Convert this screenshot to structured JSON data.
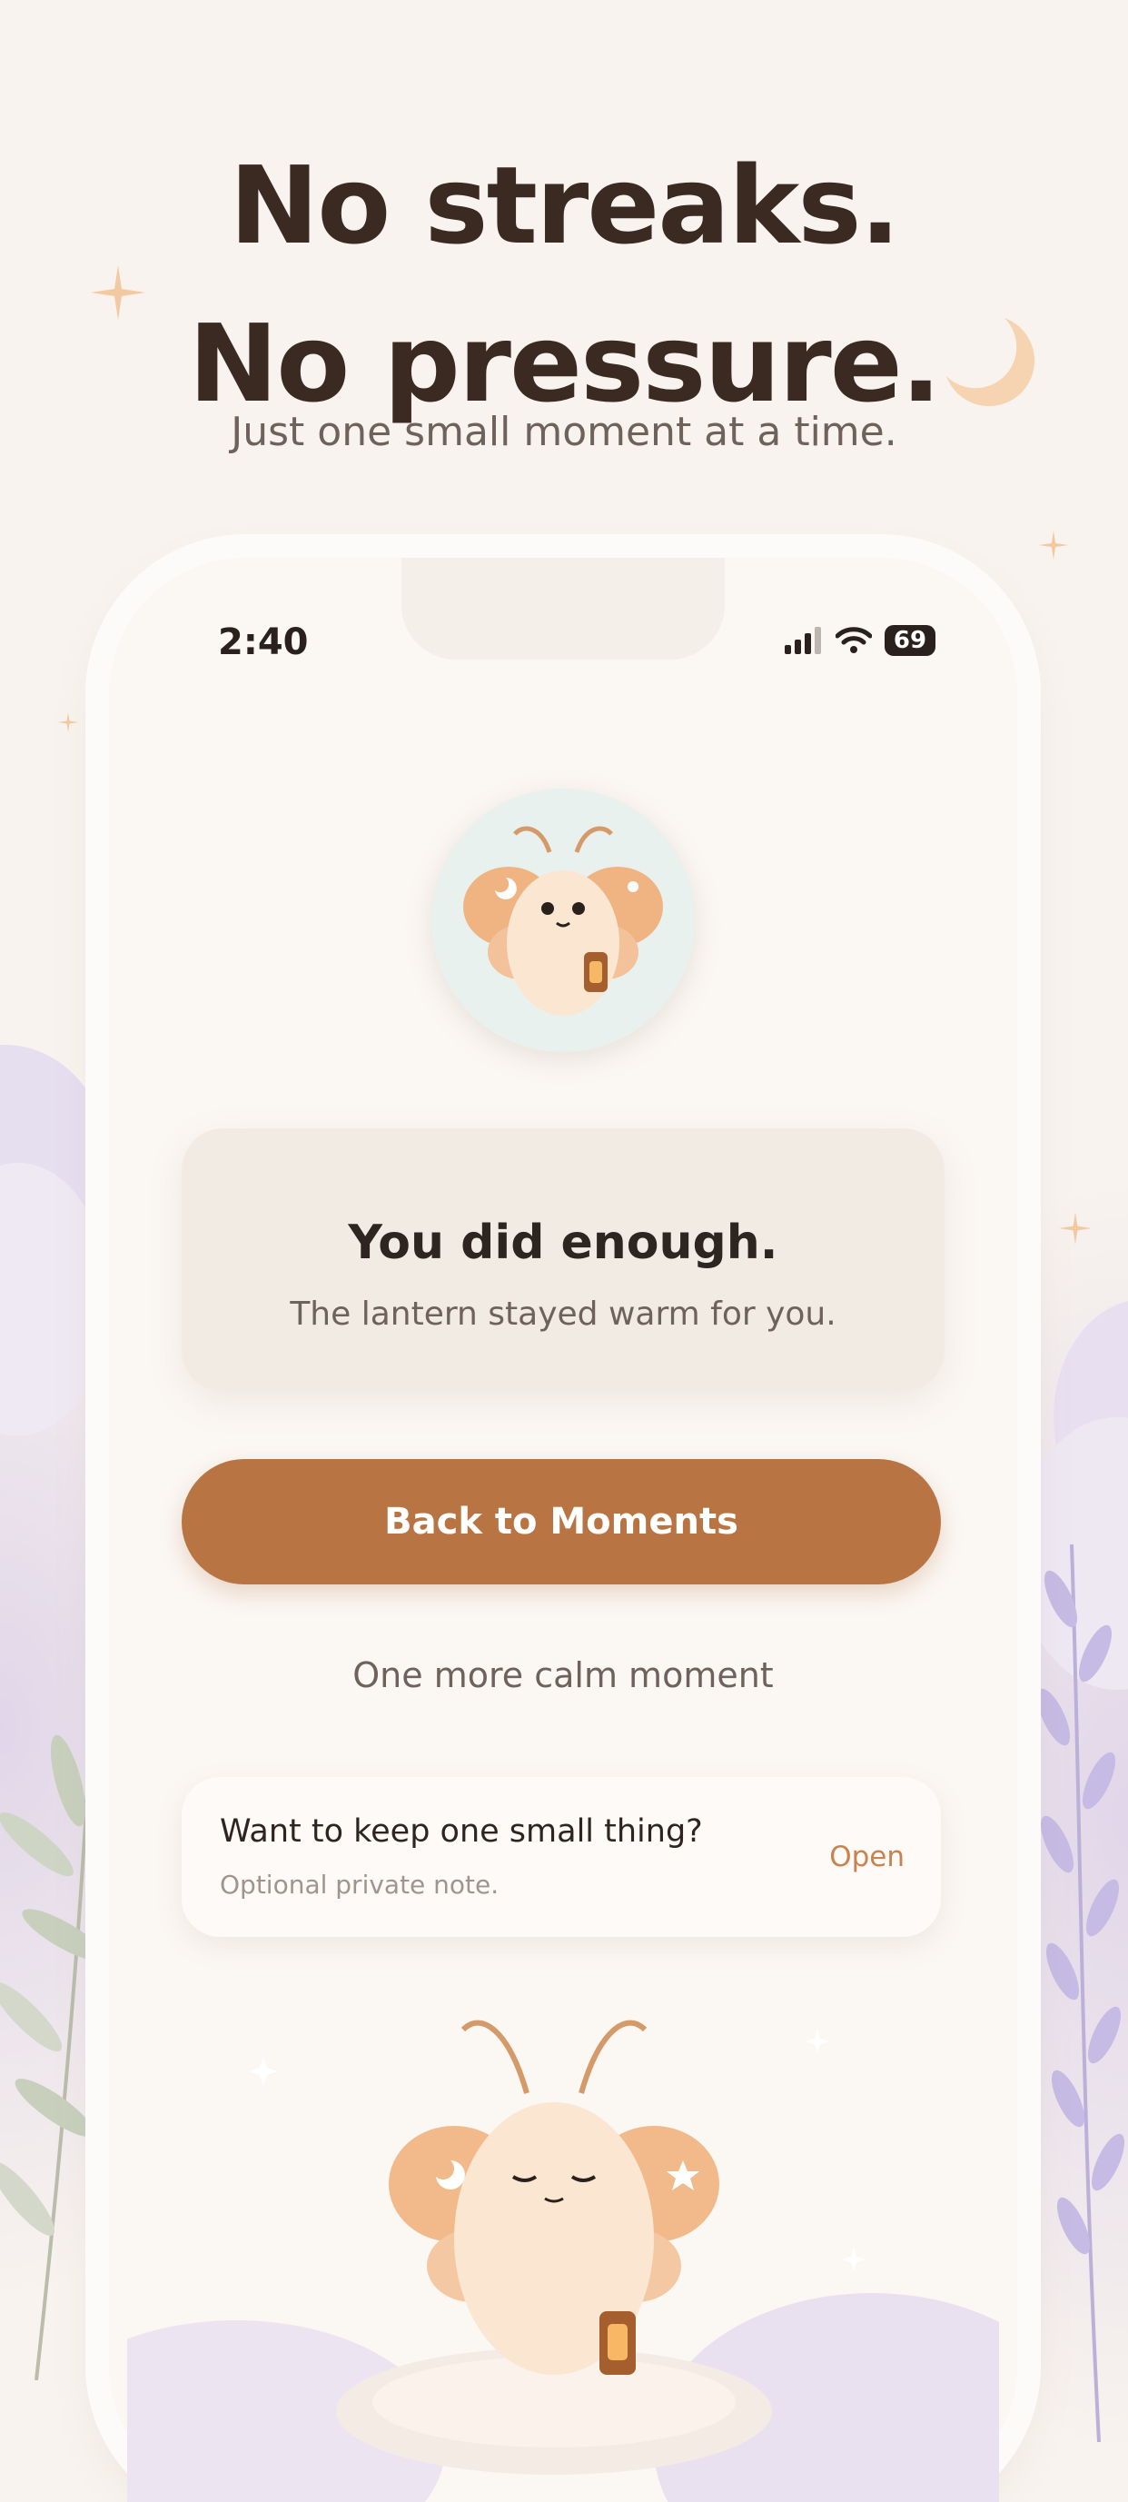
{
  "header": {
    "line1": "No streaks.",
    "line2": "No pressure.",
    "subtitle": "Just one small moment at a time."
  },
  "status_bar": {
    "time": "2:40",
    "battery": "69"
  },
  "completion_card": {
    "title": "You did enough.",
    "subtitle": "The lantern stayed warm for you."
  },
  "actions": {
    "primary_label": "Back to Moments",
    "secondary_label": "One more calm moment"
  },
  "note": {
    "title": "Want to keep one small thing?",
    "subtitle": "Optional private note.",
    "action": "Open"
  },
  "colors": {
    "background": "#f8f3ee",
    "primary": "#b87543",
    "text_dark": "#2f2520",
    "accent_orange": "#c9834f"
  },
  "icons": [
    "sparkle-icon",
    "moon-icon",
    "cellular-signal-icon",
    "wifi-icon",
    "battery-icon",
    "moth-mascot",
    "lantern-icon"
  ]
}
